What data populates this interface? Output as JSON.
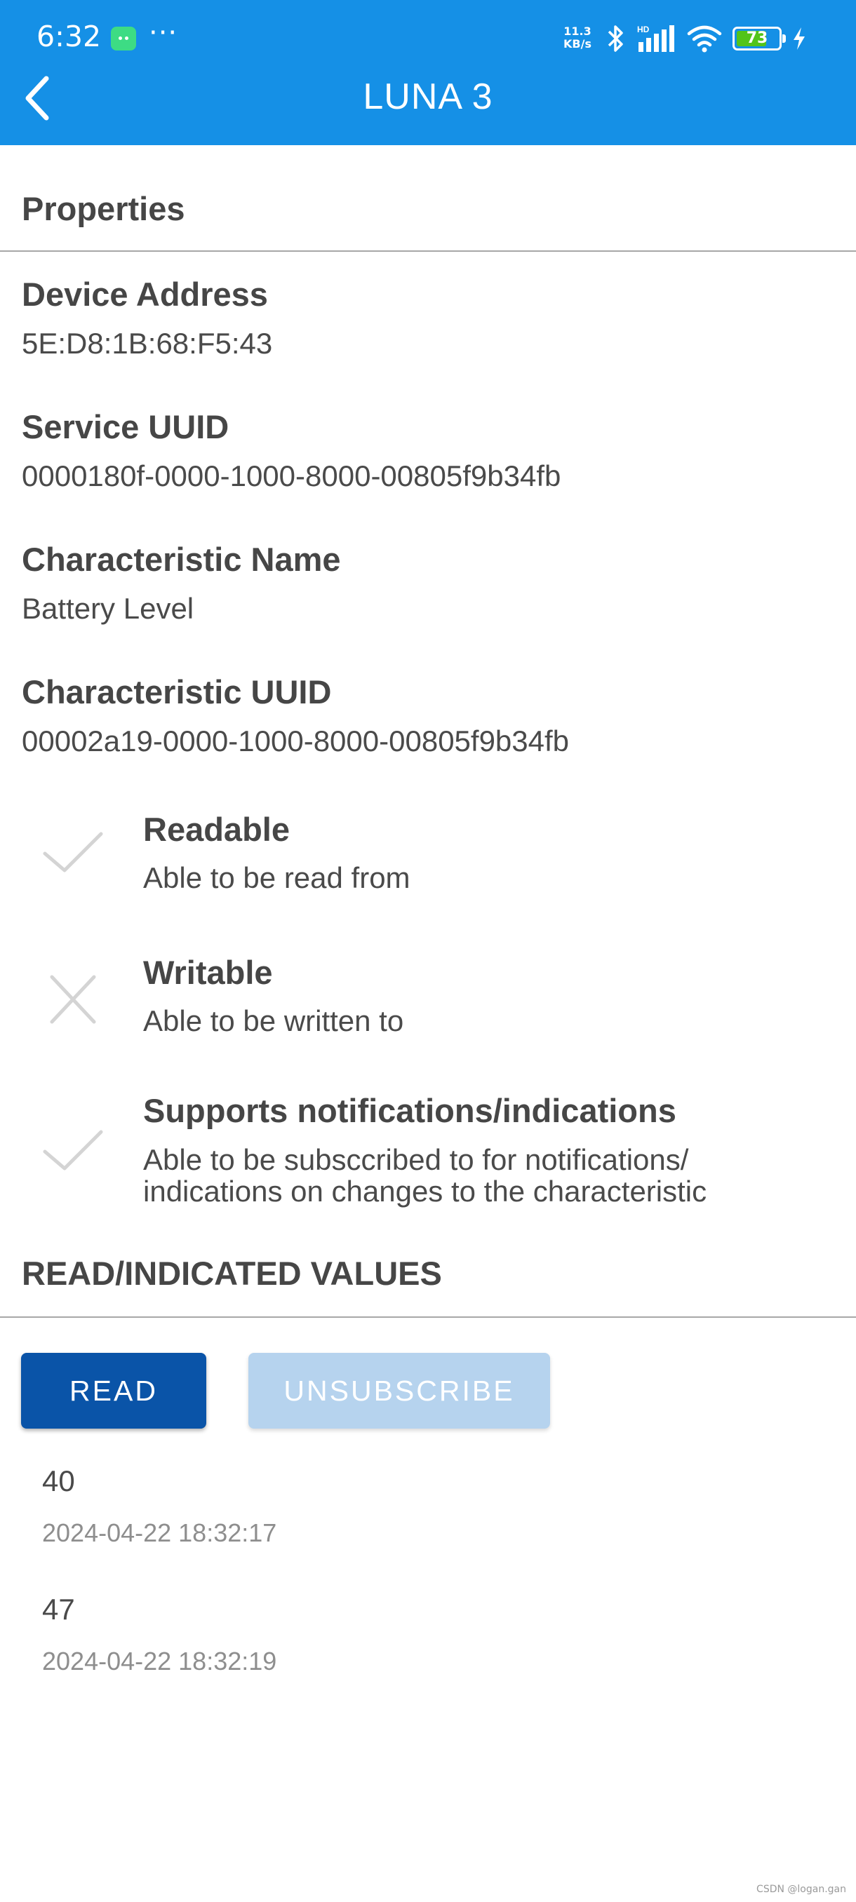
{
  "status_bar": {
    "time": "6:32",
    "more": "···",
    "net_speed_value": "11.3",
    "net_speed_unit": "KB/s",
    "hd_label": "HD",
    "battery_level": "73"
  },
  "app_bar": {
    "title": "LUNA 3"
  },
  "properties": {
    "heading": "Properties",
    "items": [
      {
        "label": "Device Address",
        "value": "5E:D8:1B:68:F5:43"
      },
      {
        "label": "Service UUID",
        "value": "0000180f-0000-1000-8000-00805f9b34fb"
      },
      {
        "label": "Characteristic Name",
        "value": "Battery Level"
      },
      {
        "label": "Characteristic UUID",
        "value": "00002a19-0000-1000-8000-00805f9b34fb"
      }
    ]
  },
  "capabilities": [
    {
      "title": "Readable",
      "description": "Able to be read from",
      "supported": true
    },
    {
      "title": "Writable",
      "description": "Able to be written to",
      "supported": false
    },
    {
      "title": "Supports notifications/indications",
      "description_line1": "Able to be subsccribed to for notifications/",
      "description_line2": "indications on changes to the characteristic",
      "supported": true
    }
  ],
  "values_section": {
    "heading": "READ/INDICATED VALUES",
    "read_button": "READ",
    "unsubscribe_button": "UNSUBSCRIBE",
    "readings": [
      {
        "value": "40",
        "timestamp": "2024-04-22 18:32:17"
      },
      {
        "value": "47",
        "timestamp": "2024-04-22 18:32:19"
      }
    ]
  },
  "watermark": "CSDN @logan.gan",
  "colors": {
    "app_bar": "#1590e6",
    "read_button": "#0a54a8",
    "unsubscribe_button_disabled": "#b6d3ee",
    "battery_fill": "#52c41a"
  }
}
